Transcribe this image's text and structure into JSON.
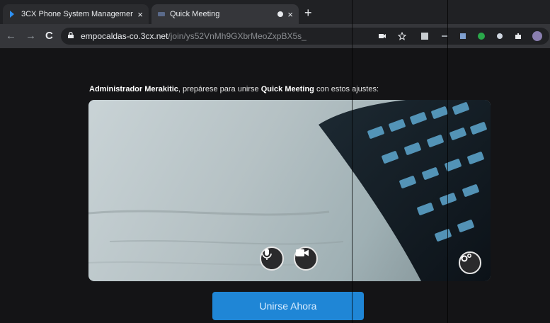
{
  "browser": {
    "tabs": [
      {
        "title": "3CX Phone System Managemen",
        "close": "×"
      },
      {
        "title": "Quick Meeting",
        "close": "×"
      }
    ],
    "new_tab": "+",
    "url_host": "empocaldas-co.3cx.net",
    "url_path": "/join/ys52VnMh9GXbrMeoZxpBX5s_",
    "nav": {
      "back": "←",
      "forward": "→",
      "reload": "C"
    }
  },
  "meeting": {
    "user_name": "Administrador Merakitic",
    "prompt_middle": ", prepárese para unirse ",
    "meeting_name": "Quick Meeting",
    "prompt_end": " con estos ajustes:",
    "join_label": "Unirse Ahora"
  },
  "colors": {
    "accent": "#1f86d6",
    "background": "#141416"
  },
  "icons": [
    "mic-icon",
    "camera-icon",
    "settings-gear-icon",
    "lock-icon",
    "star-icon",
    "extensions-icon"
  ]
}
